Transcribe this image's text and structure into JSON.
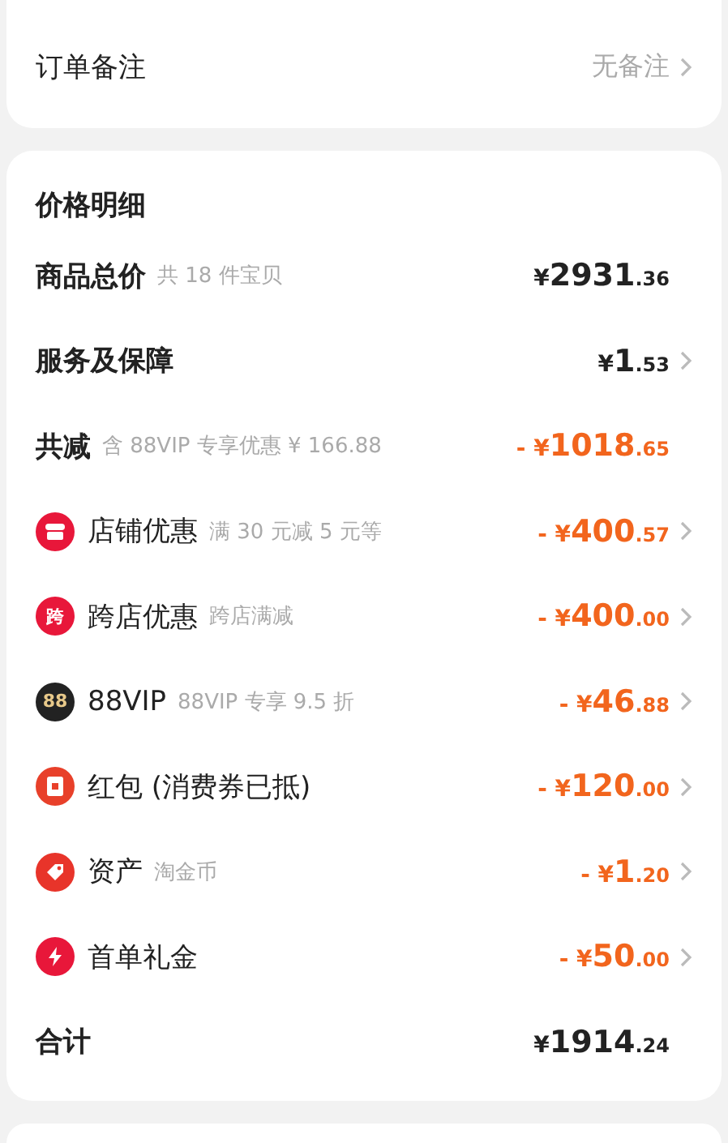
{
  "note_row": {
    "label": "订单备注",
    "value": "无备注"
  },
  "price_details": {
    "title": "价格明细",
    "rows": [
      {
        "kind": "plain",
        "label": "商品总价",
        "hint": "共 18 件宝贝",
        "discount": false,
        "prefix": "¥",
        "main": "2931",
        "fraction": ".36",
        "chevron": false
      },
      {
        "kind": "plain",
        "label": "服务及保障",
        "discount": false,
        "prefix": "¥",
        "main": "1",
        "fraction": ".53",
        "chevron": true
      },
      {
        "kind": "plain",
        "label": "共减",
        "hint": "含 88VIP 专享优惠 ¥ 166.88",
        "discount": true,
        "prefix": "- ¥",
        "main": "1018",
        "fraction": ".65",
        "chevron": false
      },
      {
        "kind": "shop",
        "label": "店铺优惠",
        "hint": "满 30 元减 5 元等",
        "discount": true,
        "prefix": "- ¥",
        "main": "400",
        "fraction": ".57",
        "chevron": true
      },
      {
        "kind": "cross",
        "badge": "跨",
        "label": "跨店优惠",
        "hint": "跨店满减",
        "discount": true,
        "prefix": "- ¥",
        "main": "400",
        "fraction": ".00",
        "chevron": true
      },
      {
        "kind": "vip",
        "badge": "88",
        "label": "88VIP",
        "hint": "88VIP 专享 9.5 折",
        "discount": true,
        "prefix": "- ¥",
        "main": "46",
        "fraction": ".88",
        "chevron": true
      },
      {
        "kind": "envelope",
        "label": "红包 (消费券已抵)",
        "discount": true,
        "prefix": "- ¥",
        "main": "120",
        "fraction": ".00",
        "chevron": true
      },
      {
        "kind": "tag",
        "label": "资产",
        "hint": "淘金币",
        "discount": true,
        "prefix": "- ¥",
        "main": "1",
        "fraction": ".20",
        "chevron": true
      },
      {
        "kind": "bolt",
        "label": "首单礼金",
        "discount": true,
        "prefix": "- ¥",
        "main": "50",
        "fraction": ".00",
        "chevron": true
      },
      {
        "kind": "plain",
        "label": "合计",
        "discount": false,
        "prefix": "¥",
        "main": "1914",
        "fraction": ".24",
        "chevron": false
      }
    ]
  }
}
